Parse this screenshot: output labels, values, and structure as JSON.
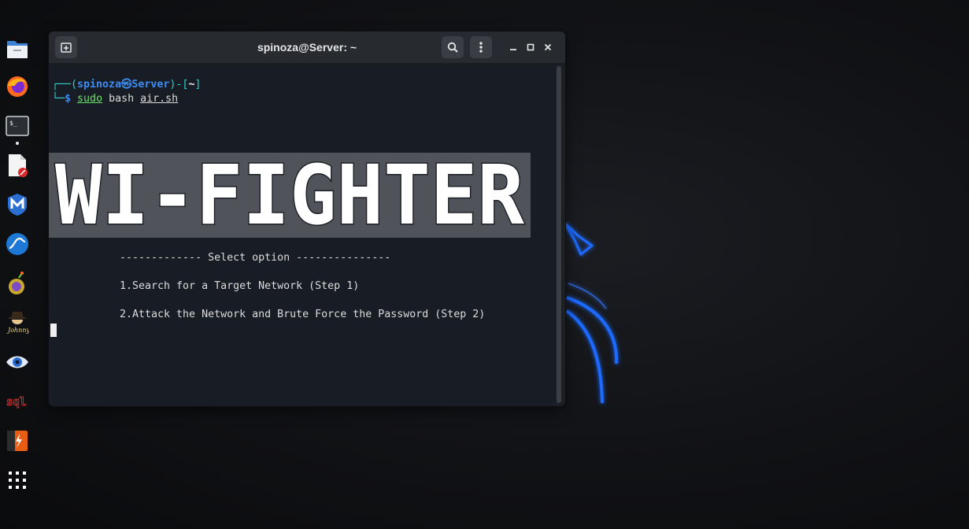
{
  "window": {
    "title": "spinoza@Server: ~"
  },
  "dock": {
    "items": [
      "files-icon",
      "firefox-icon",
      "terminal-icon",
      "text-editor-icon",
      "metasploit-icon",
      "wireshark-icon",
      "burp-icon",
      "johnny-icon",
      "eye-icon",
      "sqlmap-icon",
      "burpsuite-icon",
      "app-grid-icon"
    ]
  },
  "prompt": {
    "open": "┌──(",
    "user": "spinoza",
    "sep": "㉿",
    "host": "Server",
    "close_dir": ")-[",
    "dir": "~",
    "end": "]",
    "line2_prefix": "└─",
    "dollar": "$",
    "cmd_sudo": "sudo",
    "cmd_rest": "bash",
    "cmd_file": "air.sh"
  },
  "banner": {
    "text": "WI-FIGHTER"
  },
  "menu": {
    "header": "------------- Select option ---------------",
    "option1": "1.Search for a Target Network (Step 1)",
    "option2": "2.Attack the Network and Brute Force the Password (Step 2)"
  },
  "colors": {
    "accent_blue": "#3d8cf2",
    "accent_cyan": "#2dd1d1",
    "dragon_blue": "#1e6bff"
  }
}
